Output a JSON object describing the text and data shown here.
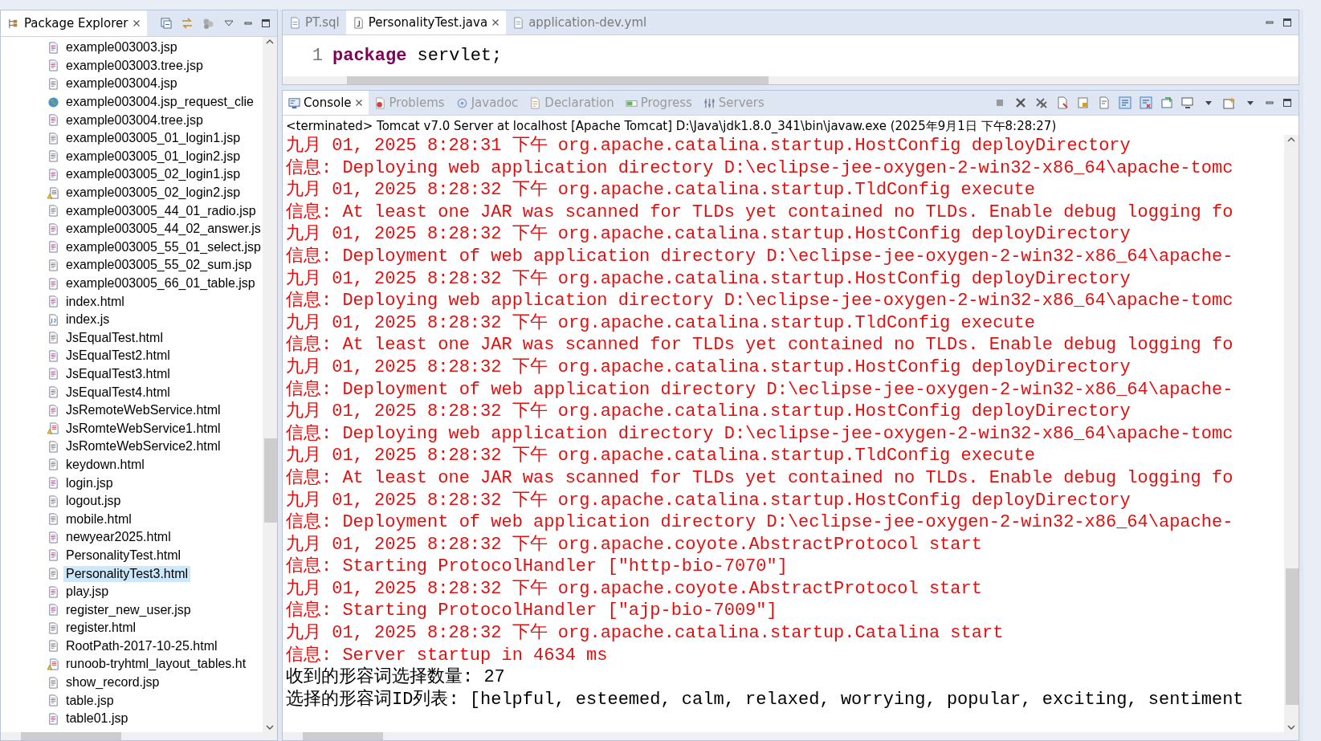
{
  "explorer": {
    "title": "Package Explorer",
    "items": [
      {
        "name": "example003003.jsp",
        "kind": "file",
        "selected": false
      },
      {
        "name": "example003003.tree.jsp",
        "kind": "file",
        "selected": false
      },
      {
        "name": "example003004.jsp",
        "kind": "file",
        "selected": false
      },
      {
        "name": "example003004.jsp_request_clie",
        "kind": "web",
        "selected": false
      },
      {
        "name": "example003004.tree.jsp",
        "kind": "file",
        "selected": false
      },
      {
        "name": "example003005_01_login1.jsp",
        "kind": "file",
        "selected": false
      },
      {
        "name": "example003005_01_login2.jsp",
        "kind": "file",
        "selected": false
      },
      {
        "name": "example003005_02_login1.jsp",
        "kind": "file",
        "selected": false
      },
      {
        "name": "example003005_02_login2.jsp",
        "kind": "warning",
        "selected": false
      },
      {
        "name": "example003005_44_01_radio.jsp",
        "kind": "file",
        "selected": false
      },
      {
        "name": "example003005_44_02_answer.js",
        "kind": "file",
        "selected": false
      },
      {
        "name": "example003005_55_01_select.jsp",
        "kind": "file",
        "selected": false
      },
      {
        "name": "example003005_55_02_sum.jsp",
        "kind": "file",
        "selected": false
      },
      {
        "name": "example003005_66_01_table.jsp",
        "kind": "file",
        "selected": false
      },
      {
        "name": "index.html",
        "kind": "file",
        "selected": false
      },
      {
        "name": "index.js",
        "kind": "script",
        "selected": false
      },
      {
        "name": "JsEqualTest.html",
        "kind": "file",
        "selected": false
      },
      {
        "name": "JsEqualTest2.html",
        "kind": "file",
        "selected": false
      },
      {
        "name": "JsEqualTest3.html",
        "kind": "file",
        "selected": false
      },
      {
        "name": "JsEqualTest4.html",
        "kind": "file",
        "selected": false
      },
      {
        "name": "JsRemoteWebService.html",
        "kind": "file",
        "selected": false
      },
      {
        "name": "JsRomteWebService1.html",
        "kind": "warning",
        "selected": false
      },
      {
        "name": "JsRomteWebService2.html",
        "kind": "file",
        "selected": false
      },
      {
        "name": "keydown.html",
        "kind": "file",
        "selected": false
      },
      {
        "name": "login.jsp",
        "kind": "file",
        "selected": false
      },
      {
        "name": "logout.jsp",
        "kind": "file",
        "selected": false
      },
      {
        "name": "mobile.html",
        "kind": "file",
        "selected": false
      },
      {
        "name": "newyear2025.html",
        "kind": "file",
        "selected": false
      },
      {
        "name": "PersonalityTest.html",
        "kind": "file",
        "selected": false
      },
      {
        "name": "PersonalityTest3.html",
        "kind": "file",
        "selected": true
      },
      {
        "name": "play.jsp",
        "kind": "file",
        "selected": false
      },
      {
        "name": "register_new_user.jsp",
        "kind": "file",
        "selected": false
      },
      {
        "name": "register.html",
        "kind": "file",
        "selected": false
      },
      {
        "name": "RootPath-2017-10-25.html",
        "kind": "file",
        "selected": false
      },
      {
        "name": "runoob-tryhtml_layout_tables.ht",
        "kind": "warning",
        "selected": false
      },
      {
        "name": "show_record.jsp",
        "kind": "file",
        "selected": false
      },
      {
        "name": "table.jsp",
        "kind": "file",
        "selected": false
      },
      {
        "name": "table01.jsp",
        "kind": "file",
        "selected": false
      }
    ]
  },
  "editor": {
    "tabs": [
      {
        "label": "PT.sql",
        "kind": "sql",
        "selected": false
      },
      {
        "label": "PersonalityTest.java",
        "kind": "java",
        "selected": true
      },
      {
        "label": "application-dev.yml",
        "kind": "text",
        "selected": false
      }
    ],
    "lines": [
      {
        "number": "1",
        "keyword": "package",
        "rest": " servlet;"
      }
    ]
  },
  "console": {
    "tabs": [
      {
        "label": "Console",
        "kind": "console",
        "selected": true
      },
      {
        "label": "Problems",
        "kind": "problems",
        "selected": false
      },
      {
        "label": "Javadoc",
        "kind": "javadoc",
        "selected": false
      },
      {
        "label": "Declaration",
        "kind": "declaration",
        "selected": false
      },
      {
        "label": "Progress",
        "kind": "progress",
        "selected": false
      },
      {
        "label": "Servers",
        "kind": "servers",
        "selected": false
      }
    ],
    "status": "<terminated> Tomcat v7.0 Server at localhost [Apache Tomcat] D:\\Java\\jdk1.8.0_341\\bin\\javaw.exe (2025年9月1日 下午8:28:27)",
    "lines": [
      {
        "kind": "err",
        "text": "九月 01, 2025 8:28:31 下午 org.apache.catalina.startup.HostConfig deployDirectory"
      },
      {
        "kind": "err",
        "text": "信息: Deploying web application directory D:\\eclipse-jee-oxygen-2-win32-x86_64\\apache-tomc"
      },
      {
        "kind": "err",
        "text": "九月 01, 2025 8:28:32 下午 org.apache.catalina.startup.TldConfig execute"
      },
      {
        "kind": "err",
        "text": "信息: At least one JAR was scanned for TLDs yet contained no TLDs. Enable debug logging fo"
      },
      {
        "kind": "err",
        "text": "九月 01, 2025 8:28:32 下午 org.apache.catalina.startup.HostConfig deployDirectory"
      },
      {
        "kind": "err",
        "text": "信息: Deployment of web application directory D:\\eclipse-jee-oxygen-2-win32-x86_64\\apache-"
      },
      {
        "kind": "err",
        "text": "九月 01, 2025 8:28:32 下午 org.apache.catalina.startup.HostConfig deployDirectory"
      },
      {
        "kind": "err",
        "text": "信息: Deploying web application directory D:\\eclipse-jee-oxygen-2-win32-x86_64\\apache-tomc"
      },
      {
        "kind": "err",
        "text": "九月 01, 2025 8:28:32 下午 org.apache.catalina.startup.TldConfig execute"
      },
      {
        "kind": "err",
        "text": "信息: At least one JAR was scanned for TLDs yet contained no TLDs. Enable debug logging fo"
      },
      {
        "kind": "err",
        "text": "九月 01, 2025 8:28:32 下午 org.apache.catalina.startup.HostConfig deployDirectory"
      },
      {
        "kind": "err",
        "text": "信息: Deployment of web application directory D:\\eclipse-jee-oxygen-2-win32-x86_64\\apache-"
      },
      {
        "kind": "err",
        "text": "九月 01, 2025 8:28:32 下午 org.apache.catalina.startup.HostConfig deployDirectory"
      },
      {
        "kind": "err",
        "text": "信息: Deploying web application directory D:\\eclipse-jee-oxygen-2-win32-x86_64\\apache-tomc"
      },
      {
        "kind": "err",
        "text": "九月 01, 2025 8:28:32 下午 org.apache.catalina.startup.TldConfig execute"
      },
      {
        "kind": "err",
        "text": "信息: At least one JAR was scanned for TLDs yet contained no TLDs. Enable debug logging fo"
      },
      {
        "kind": "err",
        "text": "九月 01, 2025 8:28:32 下午 org.apache.catalina.startup.HostConfig deployDirectory"
      },
      {
        "kind": "err",
        "text": "信息: Deployment of web application directory D:\\eclipse-jee-oxygen-2-win32-x86_64\\apache-"
      },
      {
        "kind": "err",
        "text": "九月 01, 2025 8:28:32 下午 org.apache.coyote.AbstractProtocol start"
      },
      {
        "kind": "err",
        "text": "信息: Starting ProtocolHandler [\"http-bio-7070\"]"
      },
      {
        "kind": "err",
        "text": "九月 01, 2025 8:28:32 下午 org.apache.coyote.AbstractProtocol start"
      },
      {
        "kind": "err",
        "text": "信息: Starting ProtocolHandler [\"ajp-bio-7009\"]"
      },
      {
        "kind": "err",
        "text": "九月 01, 2025 8:28:32 下午 org.apache.catalina.startup.Catalina start"
      },
      {
        "kind": "err",
        "text": "信息: Server startup in 4634 ms"
      },
      {
        "kind": "out",
        "text": "收到的形容词选择数量: 27"
      },
      {
        "kind": "out",
        "text": "选择的形容词ID列表: [helpful, esteemed, calm, relaxed, worrying, popular, exciting, sentiment"
      }
    ]
  }
}
